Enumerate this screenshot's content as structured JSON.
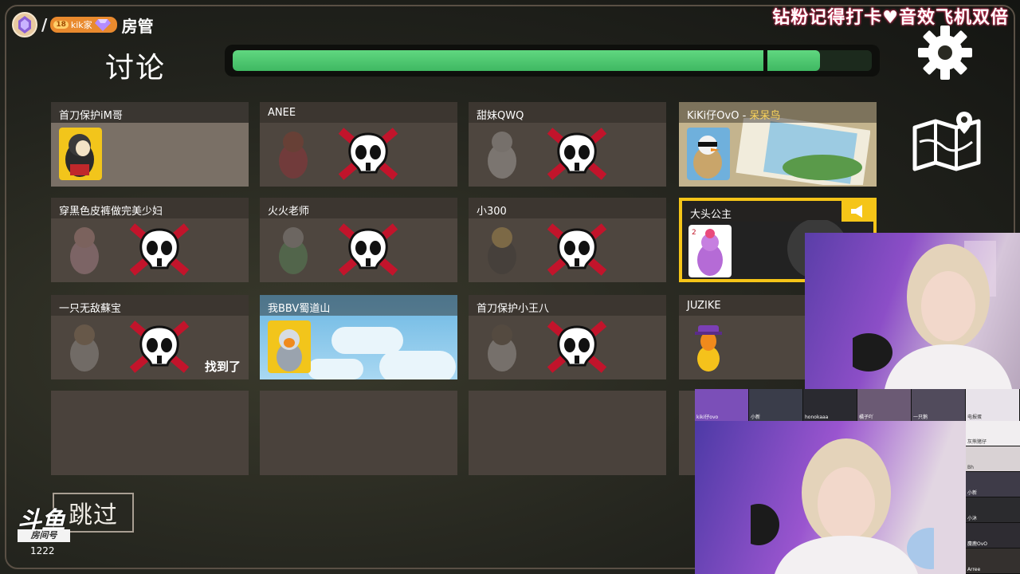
{
  "tag": {
    "level": "18",
    "family": "kik家",
    "role": "房管"
  },
  "title": "讨论",
  "banner": "钻粉记得打卡♥音效飞机双倍",
  "progress": {
    "value": 0.919,
    "marker": 0.83
  },
  "players": [
    {
      "name": "首刀保护iM哥",
      "state": "alive"
    },
    {
      "name": "ANEE",
      "state": "dead"
    },
    {
      "name": "甜妹QWQ",
      "state": "dead"
    },
    {
      "name": "KiKi仔OvO",
      "role": "呆呆鸟",
      "state": "alive"
    },
    {
      "name": "穿黑色皮裤做完美少妇",
      "state": "dead"
    },
    {
      "name": "火火老师",
      "state": "dead"
    },
    {
      "name": "小300",
      "state": "dead"
    },
    {
      "name": "大头公主",
      "state": "alive"
    },
    {
      "name": "一只无敌蘇宝",
      "state": "dead",
      "note": "找到了"
    },
    {
      "name": "我BBV蜀道山",
      "state": "alive"
    },
    {
      "name": "首刀保护小王八",
      "state": "dead"
    },
    {
      "name": "JUZIKE",
      "state": "alive"
    }
  ],
  "skip_label": "跳过",
  "platform": {
    "logo": "斗鱼",
    "room_label": "房间号",
    "room_number": "1222"
  },
  "stream_thumbs": [
    "kiki仔ovo",
    "小新",
    "honokaaa",
    "橘子吖",
    "一只鹅",
    "电报蛋",
    "灰熊猪仔",
    "Bh",
    "小新",
    "小沐",
    "麋鹿OvO",
    "Arree"
  ],
  "colors": {
    "accent_green": "#4ccb6d",
    "highlight": "#f5c518",
    "card": "#4e463f"
  }
}
